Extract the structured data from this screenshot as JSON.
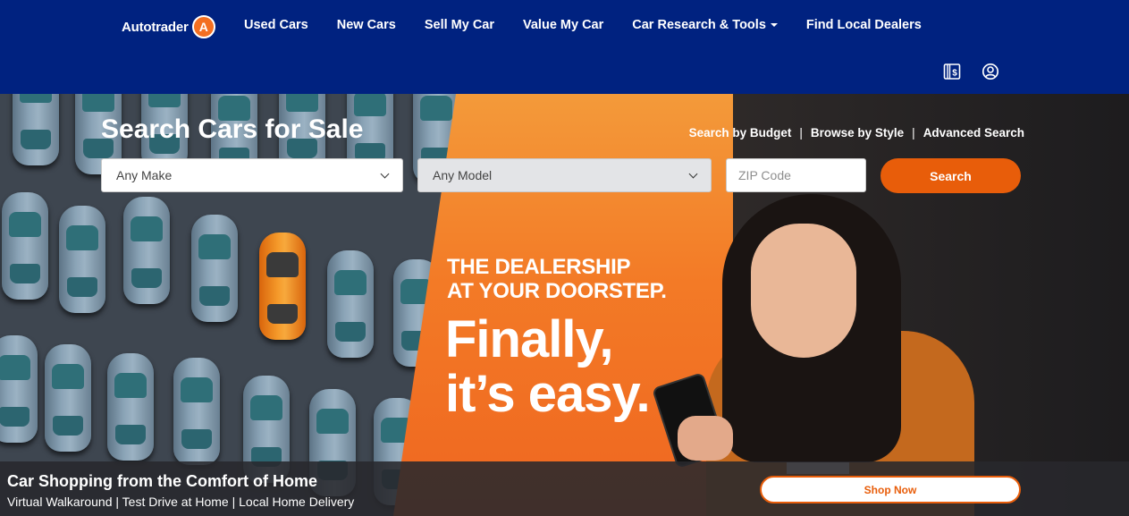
{
  "header": {
    "logo_text": "Autotrader",
    "logo_mark": "A",
    "nav": [
      {
        "label": "Used Cars"
      },
      {
        "label": "New Cars"
      },
      {
        "label": "Sell My Car"
      },
      {
        "label": "Value My Car"
      },
      {
        "label": "Car Research & Tools",
        "dropdown": true
      },
      {
        "label": "Find Local Dealers"
      }
    ],
    "icons": [
      "saved-price-icon",
      "account-icon"
    ]
  },
  "search": {
    "title": "Search Cars for Sale",
    "quick_links": [
      "Search by Budget",
      "Browse by Style",
      "Advanced Search"
    ],
    "make_value": "Any Make",
    "model_value": "Any Model",
    "zip_placeholder": "ZIP Code",
    "button_label": "Search"
  },
  "promo": {
    "tagline_line1": "THE DEALERSHIP",
    "tagline_line2": "AT YOUR DOORSTEP.",
    "headline_line1": "Finally,",
    "headline_line2": "it’s easy."
  },
  "banner": {
    "title": "Car Shopping from the Comfort of Home",
    "subtitle": "Virtual Walkaround | Test Drive at Home | Local Home Delivery",
    "button_label": "Shop Now"
  },
  "colors": {
    "header_bg": "#002280",
    "accent": "#e85d0a",
    "white": "#ffffff"
  }
}
